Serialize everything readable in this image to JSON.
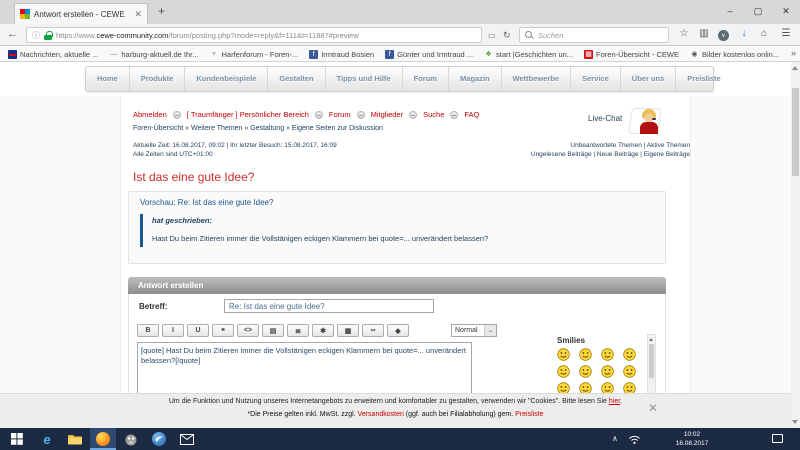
{
  "browser": {
    "tab_title": "Antwort erstellen - CEWE",
    "url_scheme": "https://www.",
    "url_domain": "cewe-community.com",
    "url_path": "/forum/posting.php?mode=reply&f=111&t=11887#preview",
    "search_placeholder": "Suchen",
    "bookmarks": [
      {
        "label": "Nachrichten, aktuelle ...",
        "glyph": "▬",
        "icon_style": "background:#12318f;color:#e3001b"
      },
      {
        "label": "harburg-aktuell.de Ihr...",
        "glyph": "—",
        "icon_style": "color:#777"
      },
      {
        "label": "Harfenforum - Foren-...",
        "glyph": "♆",
        "icon_style": "color:#5a4a3a"
      },
      {
        "label": "Irmtraud Bosien",
        "glyph": "f",
        "icon_style": "background:#3b5998;color:#fff"
      },
      {
        "label": "Günter und Irmtraud ...",
        "glyph": "f",
        "icon_style": "background:#3b5998;color:#fff"
      },
      {
        "label": "start |Geschichten un...",
        "glyph": "❖",
        "icon_style": "color:#4a9c3f"
      },
      {
        "label": "Foren-Übersicht - CEWE",
        "glyph": "▦",
        "icon_style": "background:#d51317;color:#fff"
      },
      {
        "label": "Bilder kostenlos onlin...",
        "glyph": "◉",
        "icon_style": "color:#555"
      }
    ]
  },
  "icons": {
    "minimize": "–",
    "maximize": "▢",
    "close": "✕",
    "back": "←",
    "info": "ⓘ",
    "reader": "▭",
    "reload": "↻",
    "star": "☆",
    "library": "▥",
    "pocket": "∨",
    "download": "↓",
    "home": "⌂",
    "menu": "☰",
    "new_tab": "+",
    "tab_close": "✕",
    "overflow": "»",
    "select_arrow": "⌄",
    "tray_chevron": "∧"
  },
  "site": {
    "nav_items": [
      "Home",
      "Produkte",
      "Kundenbeispiele",
      "Gestalten",
      "Tipps und Hilfe",
      "Forum",
      "Magazin",
      "Wettbewerbe",
      "Service",
      "Über uns",
      "Preisliste"
    ],
    "user_links": [
      "Abmelden",
      "[ Traumfänger ] Persönlicher Bereich",
      "Forum",
      "Mitglieder",
      "Suche",
      "FAQ"
    ],
    "breadcrumb": "Foren-Übersicht » Weitere Themen » Gestaltung » Eigene Seiten zur Diskussion",
    "live_chat_label": "Live-Chat",
    "current_time_line": "Aktuelle Zeit: 16.08.2017, 09:02 | Ihr letzter Besuch: 15.08.2017, 16:09",
    "timezone_line": "Alle Zeiten sind UTC+01:00",
    "topic_links_line1": "Unbeantwortete Themen | Aktive Themen",
    "topic_links_line2": "Ungelesene Beiträge | Neue Beiträge | Eigene Beiträge",
    "topic_title": "Ist das eine gute Idee?"
  },
  "preview": {
    "label": "Vorschau: Re: Ist das eine gute Idee?",
    "quote_author": "hat geschrieben:",
    "quote_text": "Hast Du beim Zitieren immer die Vollstänigen eckigen Klammern bei quote=... unverändert belassen?"
  },
  "reply_form": {
    "header": "Antwort erstellen",
    "subject_label": "Betreff:",
    "subject_value": "Re: Ist das eine gute Idee?",
    "toolbar": [
      {
        "name": "bold",
        "glyph": "B"
      },
      {
        "name": "italic",
        "glyph": "I"
      },
      {
        "name": "underline",
        "glyph": "U"
      },
      {
        "name": "quote",
        "glyph": "❝"
      },
      {
        "name": "code",
        "glyph": "<>"
      },
      {
        "name": "list",
        "glyph": "▤"
      },
      {
        "name": "ordered-list",
        "glyph": "≣"
      },
      {
        "name": "list-item",
        "glyph": "✱"
      },
      {
        "name": "image",
        "glyph": "▦"
      },
      {
        "name": "link",
        "glyph": "∞"
      },
      {
        "name": "color",
        "glyph": "◆"
      }
    ],
    "font_select_value": "Normal",
    "message_value": "[quote] Hast Du beim Zitieren immer die Vollstänigen eckigen Klammern bei quote=... unverändert belassen?[/quote]",
    "smilies_title": "Smilies",
    "smilies": [
      "smile",
      "grin",
      "cool",
      "lol",
      "blush",
      "razz",
      "wink",
      "surprised",
      "neutral",
      "mad",
      "confused",
      "eek"
    ]
  },
  "cookie_notice": {
    "text": "Um die Funktion und Nutzung unseres Internetangebots zu erweitern und komfortabler zu gestalten, verwenden wir \"Cookies\". Bitte lesen Sie ",
    "link": "hier",
    "suffix": ".",
    "price_pre": "*Die Preise gelten inkl. MwSt. zzgl. ",
    "price_link1": "Versandkosten",
    "price_mid": " (ggf. auch bei Filialabholung) gem. ",
    "price_link2": "Preisliste"
  },
  "taskbar": {
    "time": "10:02",
    "date": "16.08.2017"
  },
  "colors": {
    "link_red": "#cc0000",
    "heading_red": "#d02b2b",
    "navy_text": "#243f5e",
    "preview_blue": "#19588f",
    "taskbar_bg": "#1c2a44",
    "lock_green": "#12a140"
  }
}
